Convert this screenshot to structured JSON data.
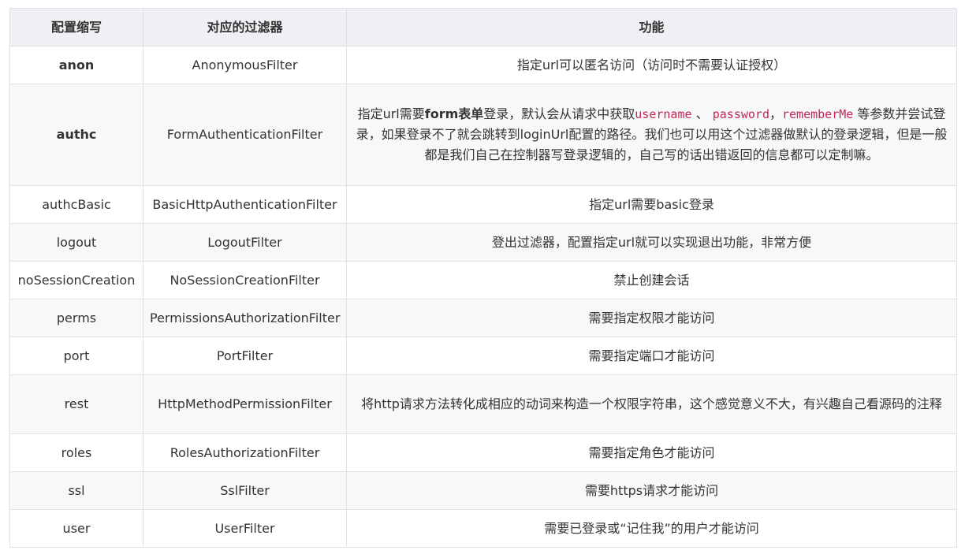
{
  "table": {
    "headers": [
      "配置缩写",
      "对应的过滤器",
      "功能"
    ],
    "rows": [
      {
        "abbr": "anon",
        "filter": "AnonymousFilter",
        "desc": "指定url可以匿名访问（访问时不需要认证授权）"
      },
      {
        "abbr": "authc",
        "filter": "FormAuthenticationFilter",
        "desc_parts": {
          "p1": "指定url需要",
          "bold": "form表单",
          "p2": "登录，默认会从请求中获取",
          "code1": "username",
          "sep1": "、",
          "code2": "password",
          "sep2": "，",
          "code3": "rememberMe",
          "p3": "等参数并尝试登录，如果登录不了就会跳转到loginUrl配置的路径。我们也可以用这个过滤器做默认的登录逻辑，但是一般都是我们自己在控制器写登录逻辑的，自己写的话出错返回的信息都可以定制嘛。"
        }
      },
      {
        "abbr": "authcBasic",
        "filter": "BasicHttpAuthenticationFilter",
        "desc": "指定url需要basic登录"
      },
      {
        "abbr": "logout",
        "filter": "LogoutFilter",
        "desc": "登出过滤器，配置指定url就可以实现退出功能，非常方便"
      },
      {
        "abbr": "noSessionCreation",
        "filter": "NoSessionCreationFilter",
        "desc": "禁止创建会话"
      },
      {
        "abbr": "perms",
        "filter": "PermissionsAuthorizationFilter",
        "desc": "需要指定权限才能访问"
      },
      {
        "abbr": "port",
        "filter": "PortFilter",
        "desc": "需要指定端口才能访问"
      },
      {
        "abbr": "rest",
        "filter": "HttpMethodPermissionFilter",
        "desc": "将http请求方法转化成相应的动词来构造一个权限字符串，这个感觉意义不大，有兴趣自己看源码的注释"
      },
      {
        "abbr": "roles",
        "filter": "RolesAuthorizationFilter",
        "desc": "需要指定角色才能访问"
      },
      {
        "abbr": "ssl",
        "filter": "SslFilter",
        "desc": "需要https请求才能访问"
      },
      {
        "abbr": "user",
        "filter": "UserFilter",
        "desc": "需要已登录或“记住我”的用户才能访问"
      }
    ]
  },
  "colors": {
    "header_bg": "#eef0f3",
    "stripe_bg": "#f6f8fa",
    "border": "#dfe2e5",
    "code": "#c7254e",
    "text": "#333333"
  }
}
